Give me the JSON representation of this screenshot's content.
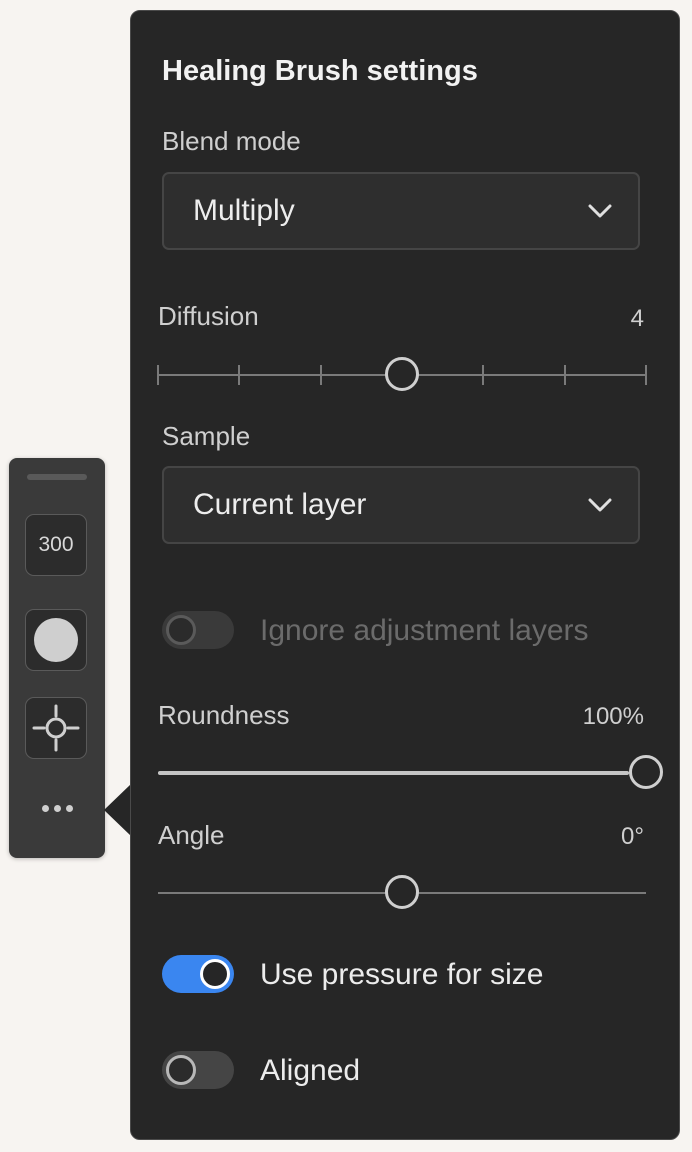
{
  "mini_toolbar": {
    "brush_size": "300",
    "icons": [
      "hardness-dot-icon",
      "crosshair-icon",
      "more-dots-icon"
    ]
  },
  "panel": {
    "title": "Healing Brush settings",
    "blend_mode": {
      "label": "Blend mode",
      "value": "Multiply",
      "icon": "chevron-down-icon"
    },
    "diffusion": {
      "label": "Diffusion",
      "value": "4",
      "level_index": 3,
      "tick_count": 7
    },
    "sample": {
      "label": "Sample",
      "value": "Current layer",
      "icon": "chevron-down-icon"
    },
    "ignore_adjustment_layers": {
      "label": "Ignore adjustment layers",
      "on": false,
      "disabled": true
    },
    "roundness": {
      "label": "Roundness",
      "value": "100%",
      "fraction": 1.0
    },
    "angle": {
      "label": "Angle",
      "value": "0°",
      "fraction": 0.5
    },
    "use_pressure_for_size": {
      "label": "Use pressure for size",
      "on": true
    },
    "aligned": {
      "label": "Aligned",
      "on": false
    }
  },
  "colors": {
    "panel_bg": "#262626",
    "accent": "#3a86f0",
    "page_bg": "#f7f4f1"
  }
}
